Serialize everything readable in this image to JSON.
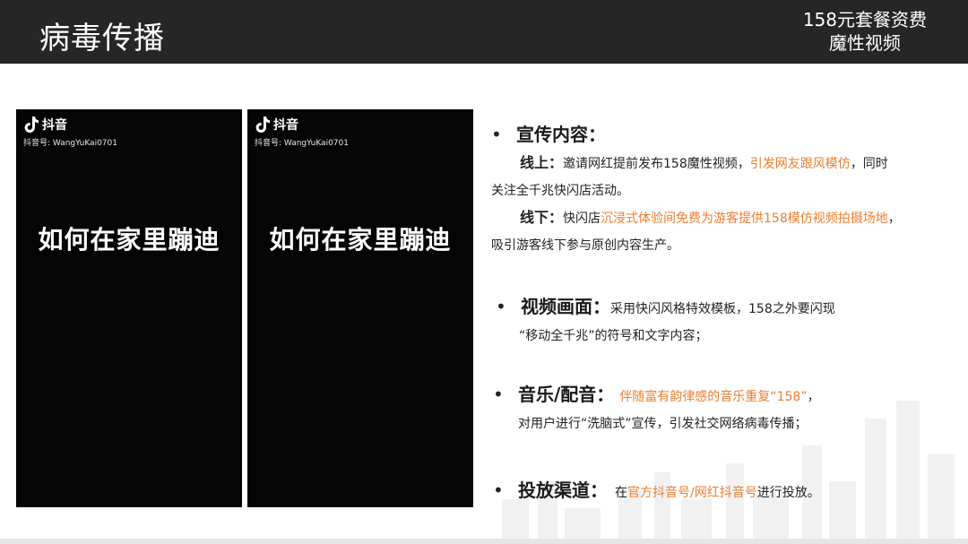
{
  "header": {
    "title": "病毒传播",
    "tag_line1": "158元套餐资费",
    "tag_line2": "魔性视频"
  },
  "phones": [
    {
      "logo_text": "抖音",
      "account": "抖音号: WangYuKai0701",
      "caption": "如何在家里蹦迪"
    },
    {
      "logo_text": "抖音",
      "account": "抖音号: WangYuKai0701",
      "caption": "如何在家里蹦迪"
    }
  ],
  "sections": {
    "promo": {
      "bullet": "•",
      "title": "宣传内容：",
      "online_label": "线上：",
      "online_text1": "邀请网红提前发布158魔性视频，",
      "online_highlight": "引发网友跟风模仿",
      "online_text2": "，同时",
      "online_text3": "关注全千兆快闪店活动。",
      "offline_label": "线下：",
      "offline_text1": "快闪店",
      "offline_highlight": "沉浸式体验间免费为游客提供158模仿视频拍摄场地",
      "offline_text2": "，",
      "offline_text3": "吸引游客线下参与原创内容生产。"
    },
    "video": {
      "bullet": "•",
      "title": "视频画面：",
      "text1": "采用快闪风格特效模板，158之外要闪现",
      "text2": "“移动全千兆”的符号和文字内容；"
    },
    "music": {
      "bullet": "•",
      "title": "音乐/配音：",
      "highlight": "伴随富有韵律感的音乐重复“158”",
      "text_end": "，",
      "text2": "对用户进行“洗脑式”宣传，引发社交网络病毒传播；"
    },
    "channel": {
      "bullet": "•",
      "title": "投放渠道：",
      "text1": "在",
      "highlight": "官方抖音号/网红抖音号",
      "text2": "进行投放。"
    }
  },
  "colors": {
    "accent": "#ed7d31",
    "header_bg": "#262626"
  }
}
